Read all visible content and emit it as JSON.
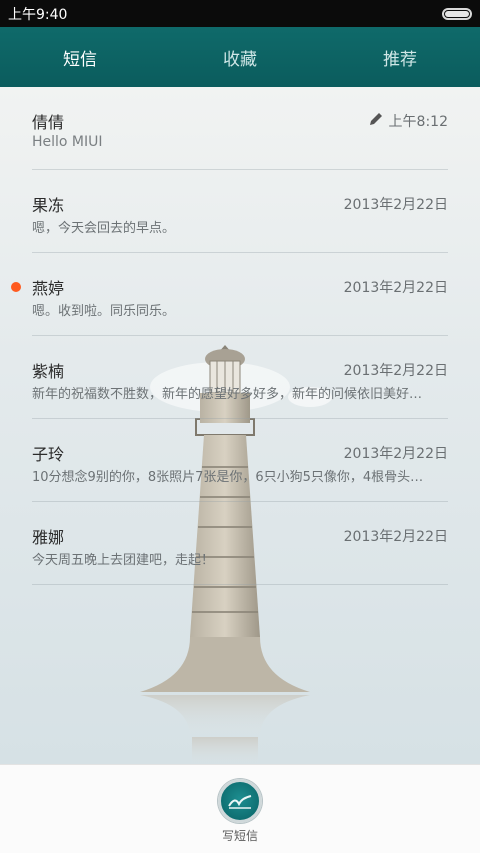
{
  "status_bar": {
    "time": "上午9:40"
  },
  "tabs": [
    {
      "label": "短信",
      "active": true
    },
    {
      "label": "收藏",
      "active": false
    },
    {
      "label": "推荐",
      "active": false
    }
  ],
  "conversations": [
    {
      "name": "倩倩",
      "date": "上午8:12",
      "preview": "Hello MIUI",
      "unread": false,
      "draft": true
    },
    {
      "name": "果冻",
      "date": "2013年2月22日",
      "preview": "嗯，今天会回去的早点。",
      "unread": false,
      "draft": false
    },
    {
      "name": "燕婷",
      "date": "2013年2月22日",
      "preview": "嗯。收到啦。同乐同乐。",
      "unread": true,
      "draft": false
    },
    {
      "name": "紫楠",
      "date": "2013年2月22日",
      "preview": "新年的祝福数不胜数，新年的愿望好多好多，新年的问候依旧美好…",
      "unread": false,
      "draft": false
    },
    {
      "name": "子玲",
      "date": "2013年2月22日",
      "preview": "10分想念9别的你，8张照片7张是你，6只小狗5只像你，4根骨头…",
      "unread": false,
      "draft": false
    },
    {
      "name": "雅娜",
      "date": "2013年2月22日",
      "preview": "今天周五晚上去团建吧，走起！",
      "unread": false,
      "draft": false
    }
  ],
  "bottom": {
    "compose_label": "写短信"
  },
  "colors": {
    "tab_bar": "#0b5c5d",
    "unread_dot": "#ff5a1f",
    "compose_button": "#0f6f72"
  }
}
